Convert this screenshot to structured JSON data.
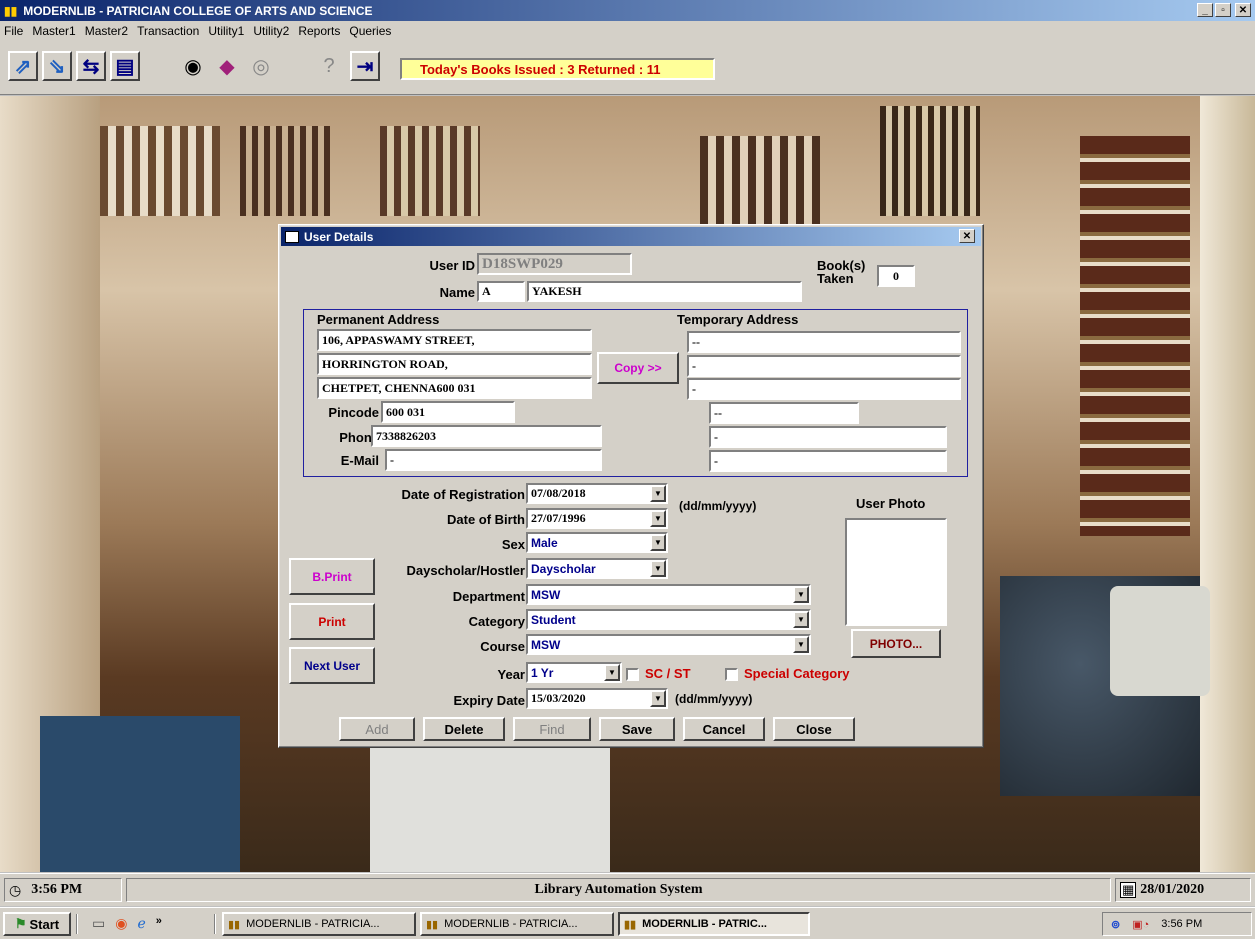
{
  "app": {
    "title": "MODERNLIB - PATRICIAN COLLEGE OF ARTS AND SCIENCE"
  },
  "menu": [
    "File",
    "Master1",
    "Master2",
    "Transaction",
    "Utility1",
    "Utility2",
    "Reports",
    "Queries"
  ],
  "toolbar": {
    "banner": "Today's Books Issued : 3 Returned : 11"
  },
  "dialog": {
    "title": "User Details",
    "user_id_label": "User ID",
    "user_id": "D18SWP029",
    "name_label": "Name",
    "name_initial": "A",
    "name_value": "YAKESH",
    "books_taken_label_1": "Book(s)",
    "books_taken_label_2": "Taken",
    "books_taken": "0",
    "permanent_label": "Permanent Address",
    "temporary_label": "Temporary Address",
    "perm_line1": "106, APPASWAMY STREET,",
    "perm_line2": "HORRINGTON ROAD,",
    "perm_line3": "CHETPET, CHENNA600 031",
    "copy_label": "Copy >>",
    "temp_line1": "--",
    "temp_line2": "-",
    "temp_line3": "-",
    "pincode_label": "Pincode",
    "pincode": "600 031",
    "temp_pincode": "--",
    "phone_label": "Phone",
    "phone": "7338826203",
    "temp_phone": "-",
    "email_label": "E-Mail",
    "email": "-",
    "temp_email": "-",
    "reg_label": "Date of Registration",
    "reg_date": "07/08/2018",
    "date_format": "(dd/mm/yyyy)",
    "dob_label": "Date of Birth",
    "dob": "27/07/1996",
    "sex_label": "Sex",
    "sex": "Male",
    "dayscholar_label": "Dayscholar/Hostler",
    "dayscholar": "Dayscholar",
    "dept_label": "Department",
    "dept": "MSW",
    "category_label": "Category",
    "category": "Student",
    "course_label": "Course",
    "course": "MSW",
    "year_label": "Year",
    "year": "1 Yr",
    "sc_st": "SC / ST",
    "special_category": "Special Category",
    "expiry_label": "Expiry Date",
    "expiry": "15/03/2020",
    "expiry_format": "(dd/mm/yyyy)",
    "user_photo_label": "User Photo",
    "photo_button": "PHOTO...",
    "bprint_button": "B.Print",
    "print_button": "Print",
    "next_user_button": "Next User",
    "add_button": "Add",
    "delete_button": "Delete",
    "find_button": "Find",
    "save_button": "Save",
    "cancel_button": "Cancel",
    "close_button": "Close"
  },
  "statusbar": {
    "time": "3:56 PM",
    "center": "Library Automation System",
    "date": "28/01/2020"
  },
  "taskbar": {
    "start": "Start",
    "tasks": [
      "MODERNLIB - PATRICIA...",
      "MODERNLIB - PATRICIA...",
      "MODERNLIB - PATRIC..."
    ],
    "clock": "3:56 PM"
  },
  "colors": {
    "title_gradient_start": "#0a246a",
    "banner_text": "#cc0000",
    "banner_bg": "#ffff99",
    "accent_magenta": "#cc00cc",
    "accent_red": "#cc0000",
    "accent_blue": "#00008b"
  }
}
